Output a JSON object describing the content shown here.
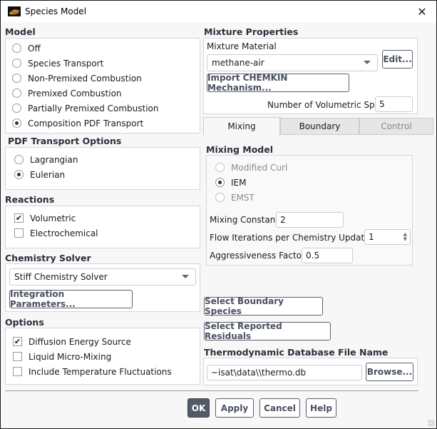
{
  "window": {
    "title": "Species Model",
    "close_icon": "close-icon",
    "app_icon": "fluent-logo-icon"
  },
  "model": {
    "header": "Model",
    "options": [
      {
        "label": "Off",
        "selected": false
      },
      {
        "label": "Species Transport",
        "selected": false
      },
      {
        "label": "Non-Premixed Combustion",
        "selected": false
      },
      {
        "label": "Premixed Combustion",
        "selected": false
      },
      {
        "label": "Partially Premixed Combustion",
        "selected": false
      },
      {
        "label": "Composition PDF Transport",
        "selected": true
      }
    ]
  },
  "pdf_transport": {
    "header": "PDF Transport Options",
    "options": [
      {
        "label": "Lagrangian",
        "selected": false
      },
      {
        "label": "Eulerian",
        "selected": true
      }
    ]
  },
  "reactions": {
    "header": "Reactions",
    "items": [
      {
        "label": "Volumetric",
        "checked": true
      },
      {
        "label": "Electrochemical",
        "checked": false
      }
    ]
  },
  "chemistry_solver": {
    "header": "Chemistry Solver",
    "selected": "Stiff Chemistry Solver",
    "integration_button": "Integration Parameters..."
  },
  "options": {
    "header": "Options",
    "items": [
      {
        "label": "Diffusion Energy Source",
        "checked": true
      },
      {
        "label": "Liquid Micro-Mixing",
        "checked": false
      },
      {
        "label": "Include Temperature Fluctuations",
        "checked": false
      }
    ]
  },
  "mixture": {
    "header": "Mixture Properties",
    "material_label": "Mixture Material",
    "material": "methane-air",
    "edit_button": "Edit...",
    "import_button": "Import CHEMKIN Mechanism...",
    "num_species_label": "Number of Volumetric Species",
    "num_species": "5"
  },
  "tabs": [
    {
      "label": "Mixing",
      "active": true
    },
    {
      "label": "Boundary",
      "active": false
    },
    {
      "label": "Control",
      "active": false,
      "disabled": true
    }
  ],
  "mixing": {
    "header": "Mixing Model",
    "options": [
      {
        "label": "Modified Curl",
        "selected": false,
        "disabled": true
      },
      {
        "label": "IEM",
        "selected": true,
        "disabled": false
      },
      {
        "label": "EMST",
        "selected": false,
        "disabled": true
      }
    ],
    "constant_label": "Mixing Constant",
    "constant": "2",
    "flow_iter_label": "Flow Iterations per Chemistry Update",
    "flow_iter": "1",
    "aggr_label": "Aggressiveness Factor",
    "aggr": "0.5"
  },
  "boundary_species_button": "Select Boundary Species",
  "reported_residuals_button": "Select Reported Residuals",
  "thermo": {
    "header": "Thermodynamic Database File Name",
    "path": "~isat\\data\\\\thermo.db",
    "browse_button": "Browse..."
  },
  "footer": {
    "ok": "OK",
    "apply": "Apply",
    "cancel": "Cancel",
    "help": "Help"
  }
}
